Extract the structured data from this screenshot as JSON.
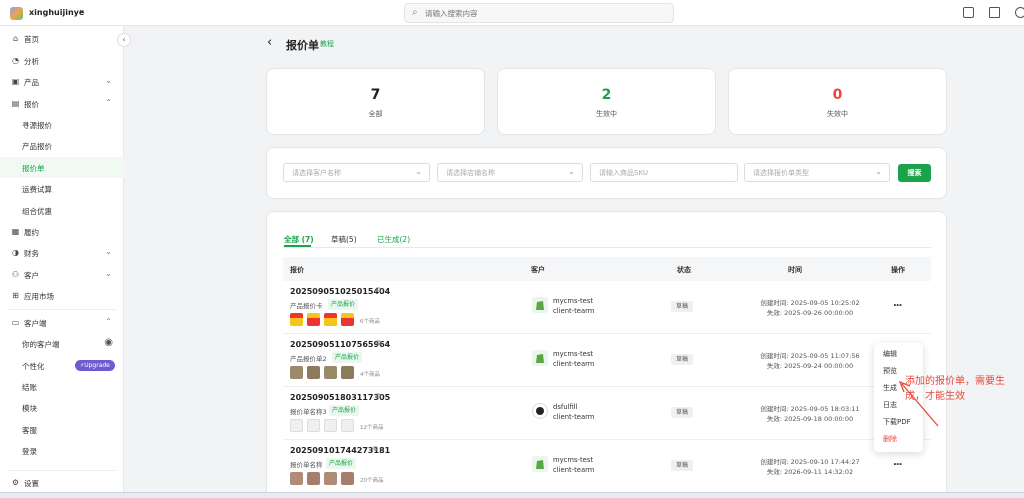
{
  "header": {
    "brand": "xinghuijinye",
    "search_placeholder": "请输入搜索内容"
  },
  "sidebar": {
    "items": [
      {
        "label": "首页",
        "icon": "home-icon"
      },
      {
        "label": "分析",
        "icon": "analytics-icon"
      },
      {
        "label": "产品",
        "icon": "box-icon"
      },
      {
        "label": "报价",
        "icon": "quote-icon"
      },
      {
        "label": "寻源报价"
      },
      {
        "label": "产品报价"
      },
      {
        "label": "报价单"
      },
      {
        "label": "运费试算"
      },
      {
        "label": "组合优惠"
      },
      {
        "label": "履约",
        "icon": "fulfill-icon"
      },
      {
        "label": "财务",
        "icon": "finance-icon"
      },
      {
        "label": "客户",
        "icon": "customer-icon"
      },
      {
        "label": "应用市场",
        "icon": "apps-icon"
      },
      {
        "label": "客户端",
        "icon": "monitor-icon"
      },
      {
        "label": "你的客户端"
      },
      {
        "label": "个性化",
        "badge": "Upgrade"
      },
      {
        "label": "结账"
      },
      {
        "label": "模块"
      },
      {
        "label": "客服"
      },
      {
        "label": "登录"
      }
    ],
    "settings": "设置"
  },
  "page": {
    "title": "报价单",
    "title_link": "教程"
  },
  "stats": [
    {
      "value": "7",
      "label": "全部",
      "color": "#1f1f1f"
    },
    {
      "value": "2",
      "label": "生效中",
      "color": "#1aa34a"
    },
    {
      "value": "0",
      "label": "失效中",
      "color": "#e8473a"
    }
  ],
  "filters": {
    "customer": "请选择客户名称",
    "store": "请选择店铺名称",
    "sku": "请输入商品SKU",
    "type": "请选择报价单类型",
    "search_button": "搜索"
  },
  "tabs": [
    {
      "label": "全部 (7)",
      "active": true
    },
    {
      "label": "草稿(5)",
      "active": false
    },
    {
      "label": "已生成(2)",
      "active": false
    }
  ],
  "table": {
    "headers": [
      "报价",
      "客户",
      "状态",
      "时间",
      "操作"
    ],
    "rows": [
      {
        "no": "20250905102501540​4",
        "name": "产品报价卡",
        "tag": "产品报价",
        "count": "6个商品",
        "customer1": "mycms-test",
        "customer2": "client-tearm",
        "status": "草稿",
        "t1": "创建时间: 2025-09-05 10:25:02",
        "t2": "失效: 2025-09-26 00:00:00",
        "ops": "..."
      },
      {
        "no": "20250905110756596​4",
        "name": "产品报价单2",
        "tag": "产品报价",
        "count": "4个商品",
        "customer1": "mycms-test",
        "customer2": "client-tearm",
        "status": "草稿",
        "t1": "创建时间: 2025-09-05 11:07:56",
        "t2": "失效: 2025-09-24 00:00:00",
        "ops": ""
      },
      {
        "no": "20250905180311730​5",
        "name": "报价单名称3",
        "tag": "产品报价",
        "count": "12个商品",
        "customer1": "dsfulfill",
        "customer2": "client-tearm",
        "status": "草稿",
        "t1": "创建时间: 2025-09-05 18:03:11",
        "t2": "失效: 2025-09-18 00:00:00",
        "ops": ""
      },
      {
        "no": "20250910174427318​1",
        "name": "报价单名称",
        "tag": "产品报价",
        "count": "20个商品",
        "customer1": "mycms-test",
        "customer2": "client-tearm",
        "status": "草稿",
        "t1": "创建时间: 2025-09-10 17:44:27",
        "t2": "失效: 2026-09-11 14:32:02",
        "ops": "..."
      }
    ]
  },
  "action_menu": [
    "编辑",
    "预览",
    "生成",
    "日志",
    "下载PDF",
    "删除"
  ],
  "annotation": "添加的报价单，需要生成，才能生效"
}
